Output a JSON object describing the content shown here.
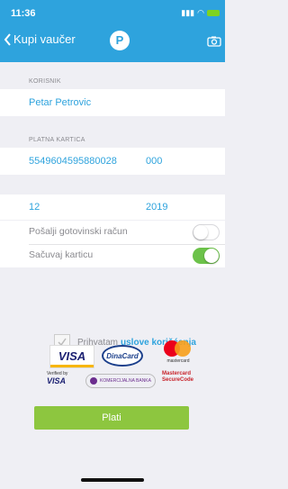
{
  "status": {
    "time": "11:36"
  },
  "header": {
    "back_label": "Kupi vaučer",
    "logo_letter": "P"
  },
  "form": {
    "user_section": "KORISNIK",
    "user_name": "Petar Petrovic",
    "card_section": "PLATNA KARTICA",
    "card_number": "5549604595880028",
    "cvv": "000",
    "exp_month": "12",
    "exp_year": "2019"
  },
  "toggles": {
    "cash_receipt_label": "Pošalji gotovinski račun",
    "cash_receipt_on": false,
    "save_card_label": "Sačuvaj karticu",
    "save_card_on": true
  },
  "terms": {
    "prefix": "Prihvatam",
    "link": "uslove korišćenja",
    "checked": true
  },
  "logos": {
    "visa": "VISA",
    "dinacard": "DinaCard",
    "mastercard": "mastercard",
    "verified_by": "Verified by",
    "verified_visa": "VISA",
    "bank": "KOMERCIJALNA BANKA",
    "mc_secure_1": "Mastercard",
    "mc_secure_2": "SecureCode"
  },
  "pay_button": "Plati",
  "colors": {
    "accent": "#2ea3dd",
    "pay": "#8dc63f",
    "toggle_on": "#6cc24a"
  }
}
